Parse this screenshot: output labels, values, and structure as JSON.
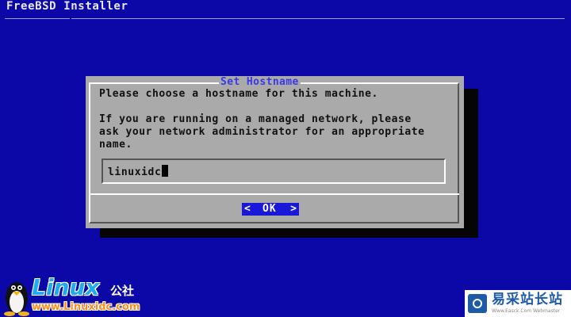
{
  "app": {
    "title": "FreeBSD Installer"
  },
  "dialog": {
    "title": "Set Hostname",
    "prompt_lines": [
      "Please choose a hostname for this machine.",
      "",
      "If you are running on a managed network, please",
      "ask your network administrator for an appropriate",
      "name."
    ],
    "hostname_value": "linuxidc",
    "ok_left": "<",
    "ok_label": "OK",
    "ok_right": ">"
  },
  "watermarks": {
    "linux_word": "Linux",
    "linux_cn": "公社",
    "linux_url": "www.Linuxidc.com",
    "site_name": "易采站长站",
    "site_sub": "Www.Easck.Com Webmaster"
  },
  "colors": {
    "background": "#0c08a8",
    "dialog": "#aaaaaa",
    "title_accent": "#3a38e8",
    "button": "#1a18d8"
  }
}
